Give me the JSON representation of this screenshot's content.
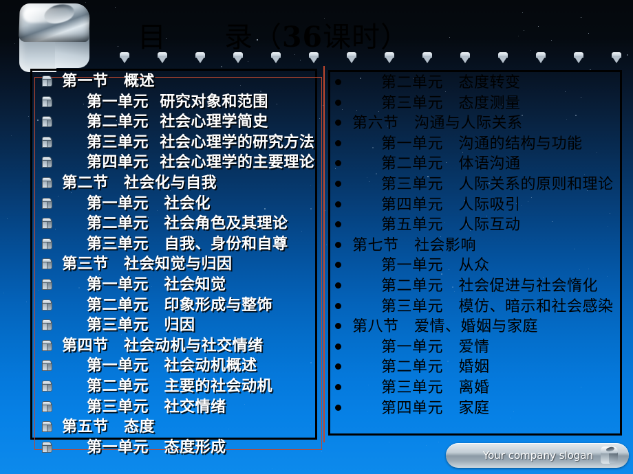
{
  "slide": {
    "title_prefix": "目　　录（",
    "title_number": "36",
    "title_suffix": "课时）",
    "title_full": "目　　录（36课时）",
    "logo_icon": "chrome-cube-logo",
    "background": {
      "top_color": "#05080c",
      "bottom_color": "#0d8aec",
      "starfield": true
    },
    "accent_colors": {
      "box_border": "#000000",
      "selection_outline": "#c0482e",
      "left_text": "#ffffff",
      "right_text": "#000000",
      "blue": "#0d8aec"
    }
  },
  "title_strip": {
    "gem_icon": "diamond-gem-icon",
    "gem_count": 14
  },
  "left_column": {
    "bullet_icon": "cube-bullet-icon",
    "items": [
      {
        "level": "sec",
        "text": "第一节　概述"
      },
      {
        "level": "unit",
        "text": "第一单元  研究对象和范围"
      },
      {
        "level": "unit",
        "text": "第二单元  社会心理学简史"
      },
      {
        "level": "unit",
        "text": "第三单元  社会心理学的研究方法"
      },
      {
        "level": "unit",
        "text": "第四单元  社会心理学的主要理论"
      },
      {
        "level": "sec",
        "text": "第二节　社会化与自我"
      },
      {
        "level": "unit",
        "text": "第一单元　社会化"
      },
      {
        "level": "unit",
        "text": "第二单元　社会角色及其理论"
      },
      {
        "level": "unit",
        "text": "第三单元　自我、身份和自尊"
      },
      {
        "level": "sec",
        "text": "第三节　社会知觉与归因"
      },
      {
        "level": "unit",
        "text": "第一单元　社会知觉"
      },
      {
        "level": "unit",
        "text": "第二单元　印象形成与整饰"
      },
      {
        "level": "unit",
        "text": "第三单元　归因"
      },
      {
        "level": "sec",
        "text": "第四节　社会动机与社交情绪"
      },
      {
        "level": "unit",
        "text": "第一单元　社会动机概述"
      },
      {
        "level": "unit",
        "text": "第二单元　主要的社会动机"
      },
      {
        "level": "unit",
        "text": "第三单元　社交情绪"
      },
      {
        "level": "sec",
        "text": "第五节　态度"
      },
      {
        "level": "unit",
        "text": "第一单元　态度形成"
      }
    ]
  },
  "right_column": {
    "bullet_icon": "round-bullet-icon",
    "items": [
      {
        "level": "unit",
        "text": "第二单元　态度转变"
      },
      {
        "level": "unit",
        "text": "第三单元　态度测量"
      },
      {
        "level": "sec",
        "text": "第六节　沟通与人际关系"
      },
      {
        "level": "unit",
        "text": "第一单元　沟通的结构与功能"
      },
      {
        "level": "unit",
        "text": "第二单元　体语沟通"
      },
      {
        "level": "unit",
        "text": "第三单元　人际关系的原则和理论"
      },
      {
        "level": "unit",
        "text": "第四单元　人际吸引"
      },
      {
        "level": "unit",
        "text": "第五单元　人际互动"
      },
      {
        "level": "sec",
        "text": "第七节　社会影响"
      },
      {
        "level": "unit",
        "text": "第一单元　从众"
      },
      {
        "level": "unit",
        "text": "第二单元　社会促进与社会惰化"
      },
      {
        "level": "unit",
        "text": "第三单元　模仿、暗示和社会感染"
      },
      {
        "level": "sec",
        "text": "第八节　爱情、婚姻与家庭"
      },
      {
        "level": "unit",
        "text": "第一单元　爱情"
      },
      {
        "level": "unit",
        "text": "第二单元　婚姻"
      },
      {
        "level": "unit",
        "text": "第三单元　离婚"
      },
      {
        "level": "unit",
        "text": "第四单元　家庭"
      }
    ]
  },
  "footer": {
    "slogan": "Your company slogan",
    "icon": "chrome-cube-icon"
  }
}
